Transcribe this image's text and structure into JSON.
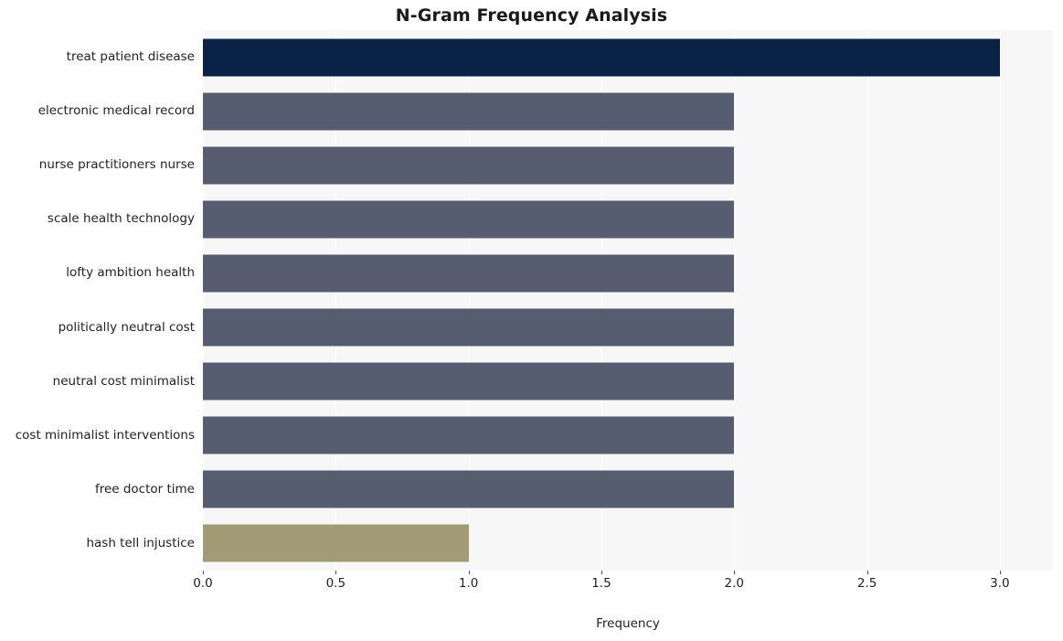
{
  "chart_data": {
    "type": "bar",
    "orientation": "horizontal",
    "title": "N-Gram Frequency Analysis",
    "xlabel": "Frequency",
    "ylabel": "",
    "categories": [
      "treat patient disease",
      "electronic medical record",
      "nurse practitioners nurse",
      "scale health technology",
      "lofty ambition health",
      "politically neutral cost",
      "neutral cost minimalist",
      "cost minimalist interventions",
      "free doctor time",
      "hash tell injustice"
    ],
    "values": [
      3,
      2,
      2,
      2,
      2,
      2,
      2,
      2,
      2,
      1
    ],
    "bar_colors": [
      "#0b2247",
      "#575d70",
      "#575d70",
      "#575d70",
      "#575d70",
      "#575d70",
      "#575d70",
      "#575d70",
      "#575d70",
      "#a39a76"
    ],
    "xlim": [
      0,
      3.2
    ],
    "xticks": [
      0.0,
      0.5,
      1.0,
      1.5,
      2.0,
      2.5,
      3.0
    ],
    "xticklabels": [
      "0.0",
      "0.5",
      "1.0",
      "1.5",
      "2.0",
      "2.5",
      "3.0"
    ],
    "grid": "vertical-white-on-gray",
    "plot_background": "#f7f7f7",
    "figure_background": "#ffffff",
    "legend": null
  }
}
